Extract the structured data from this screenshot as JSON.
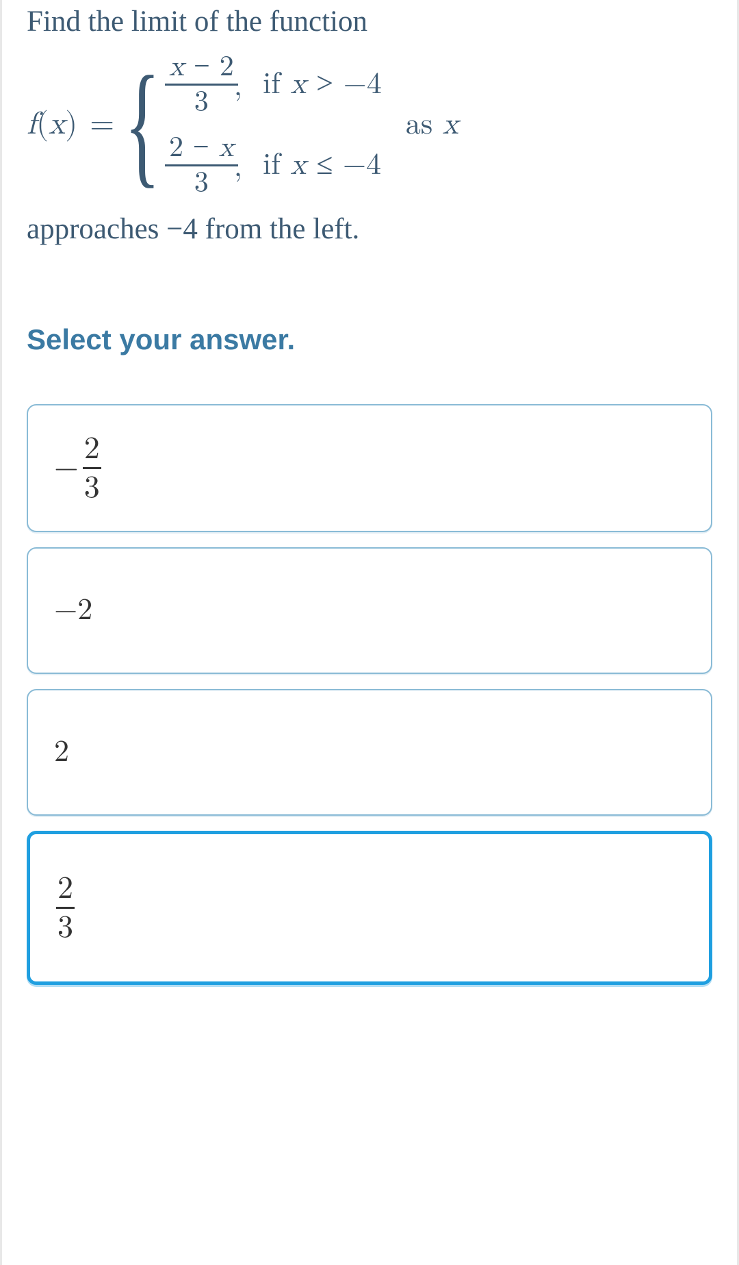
{
  "question": {
    "line1": "Find the limit of the function",
    "fx_label": "f(x)",
    "equals": "=",
    "case1_num": "x − 2",
    "case1_den": "3",
    "case1_cond": "if x > −4",
    "case2_num": "2 − x",
    "case2_den": "3",
    "case2_cond": "if x ≤ −4",
    "as_x": "as x",
    "line3": "approaches −4 from the left."
  },
  "prompt": "Select your answer.",
  "options": [
    {
      "type": "negfrac",
      "num": "2",
      "den": "3"
    },
    {
      "type": "plain",
      "text": "−2"
    },
    {
      "type": "plain",
      "text": "2"
    },
    {
      "type": "frac",
      "num": "2",
      "den": "3",
      "selected": true
    }
  ]
}
